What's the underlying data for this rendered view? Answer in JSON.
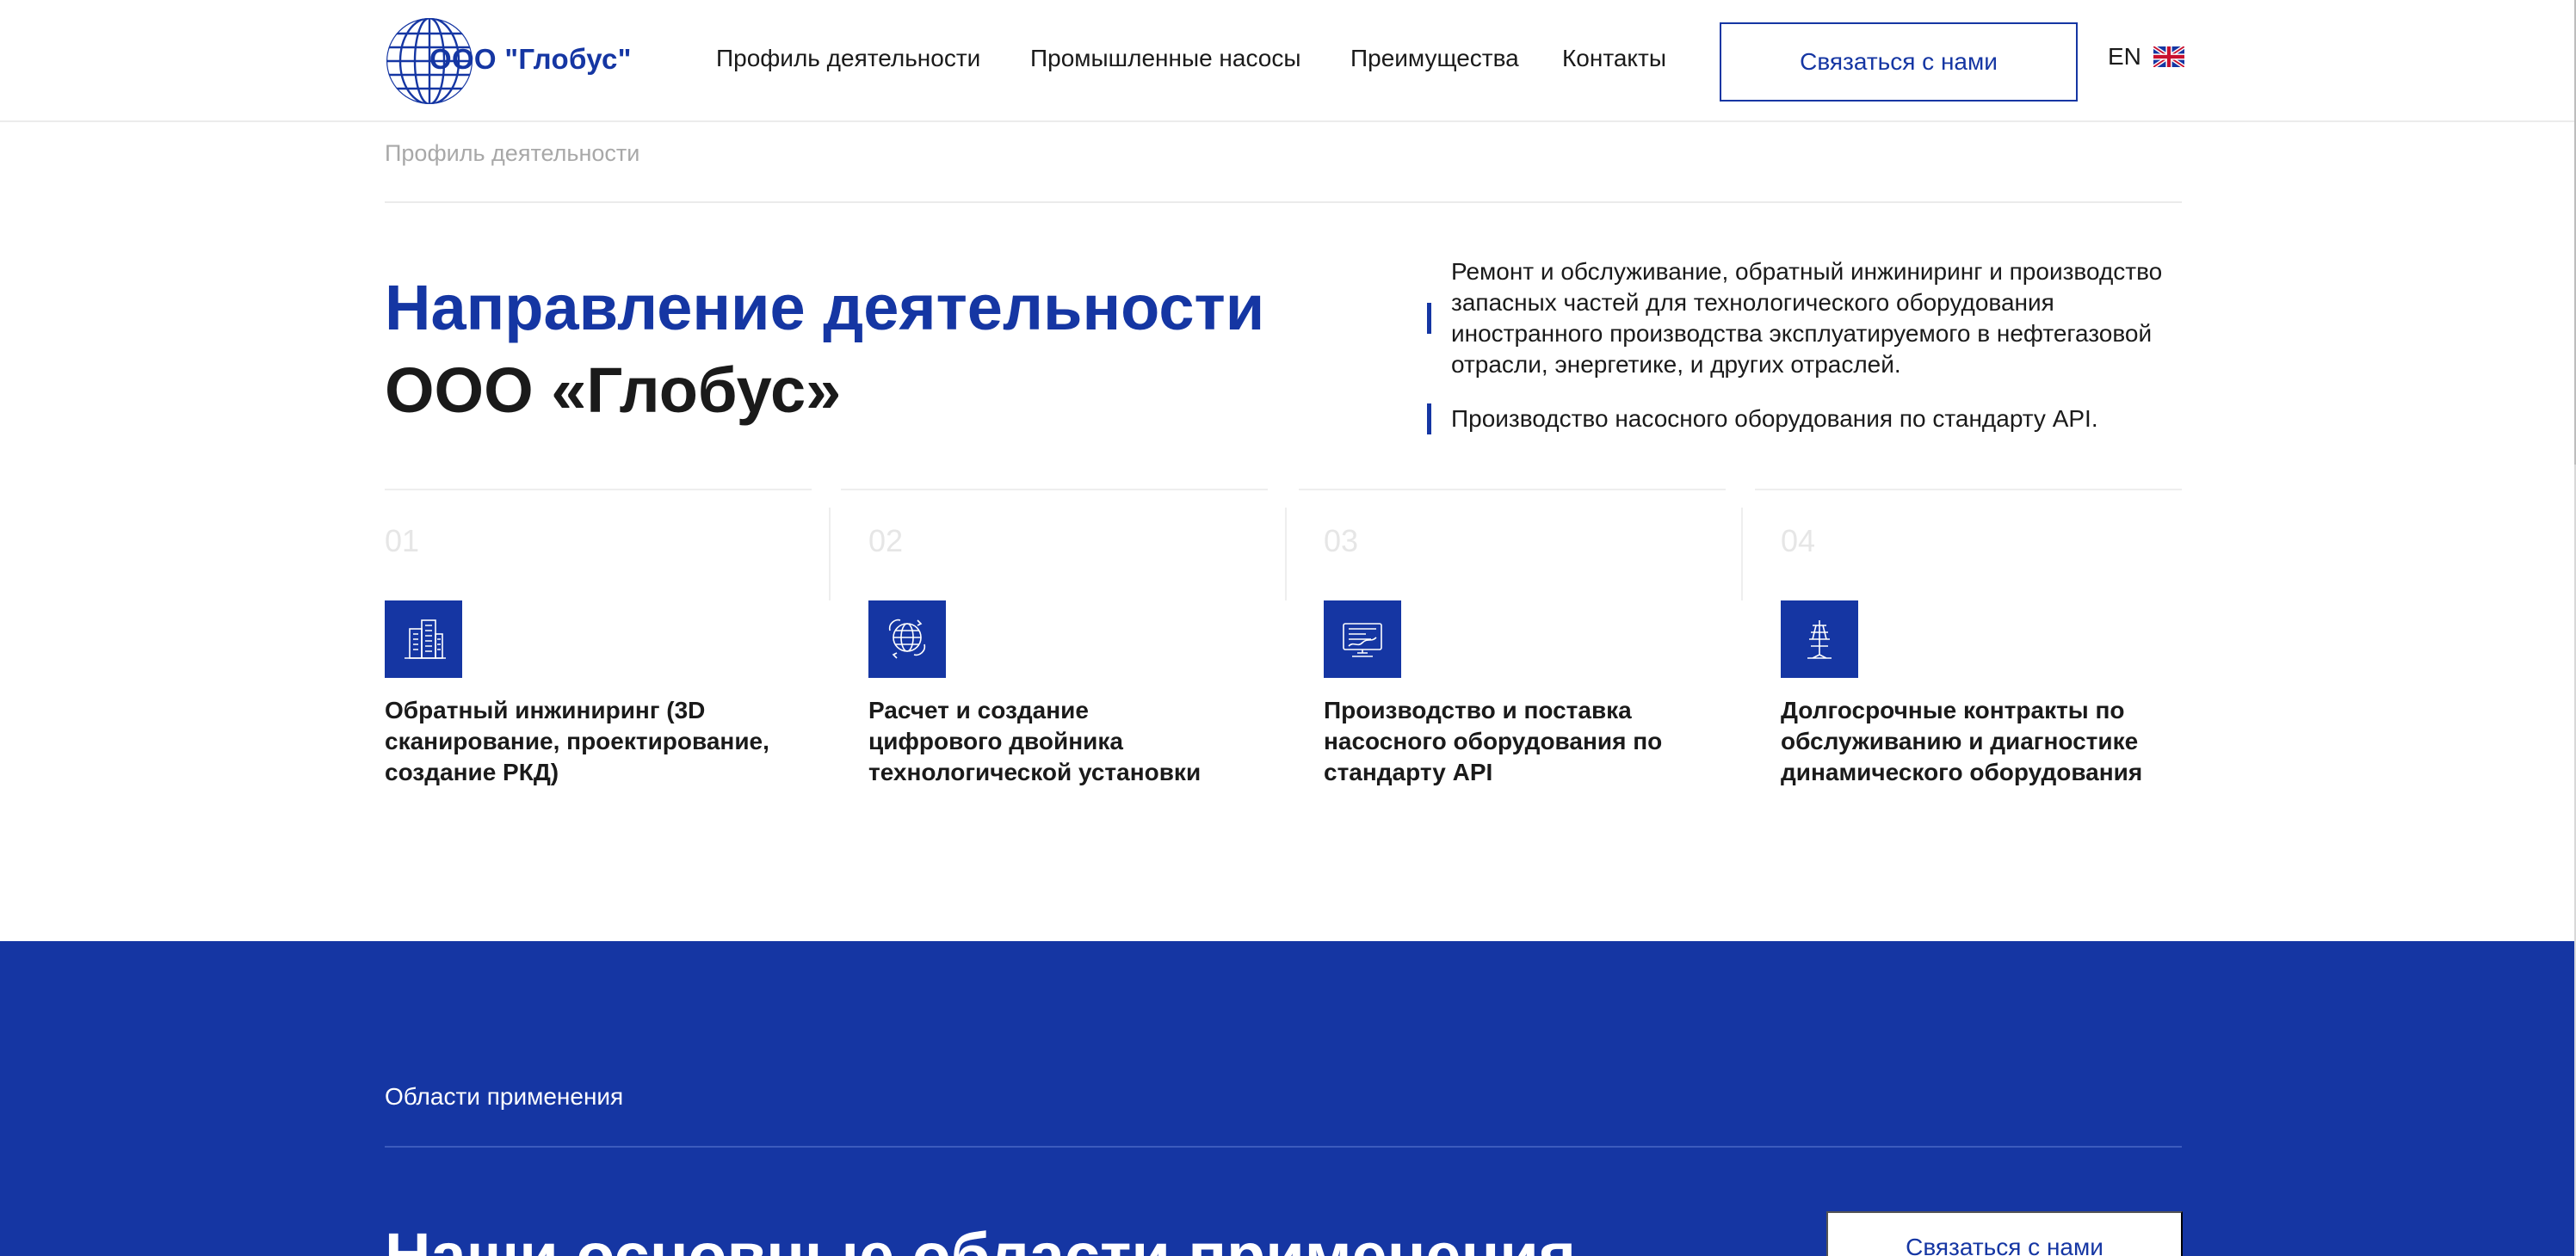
{
  "header": {
    "logo_text": "ООО \"Глобус\"",
    "nav": [
      {
        "label": "Профиль деятельности"
      },
      {
        "label": "Промышленные насосы"
      },
      {
        "label": "Преимущества"
      },
      {
        "label": "Контакты"
      }
    ],
    "contact_button": "Связаться с нами",
    "lang": {
      "label": "EN",
      "flag_icon": "uk-flag-icon"
    }
  },
  "breadcrumb": "Профиль деятельности",
  "hero": {
    "title_line_1": "Направление деятельности",
    "title_line_2": "ООО «Глобус»",
    "bullets": [
      {
        "lines": [
          "Ремонт и обслуживание, обратный инжиниринг и производство",
          "запасных частей для технологического оборудования",
          "иностранного производства эксплуатируемого в нефтегазовой",
          "отрасли, энергетике, и других отраслей."
        ]
      },
      {
        "lines": [
          "Производство насосного оборудования по стандарту API."
        ]
      }
    ]
  },
  "cards": [
    {
      "number": "01",
      "icon": "buildings-icon",
      "title_lines": [
        "Обратный инжиниринг (3D",
        "сканирование, проектирование,",
        "создание РКД)"
      ]
    },
    {
      "number": "02",
      "icon": "globe-network-icon",
      "title_lines": [
        "Расчет и создание",
        "цифрового двойника",
        "технологической установки"
      ]
    },
    {
      "number": "03",
      "icon": "monitor-chart-icon",
      "title_lines": [
        "Производство и поставка",
        "насосного оборудования по",
        "стандарту API"
      ]
    },
    {
      "number": "04",
      "icon": "antenna-tower-icon",
      "title_lines": [
        "Долгосрочные контракты по",
        "обслуживанию и диагностике",
        "динамического оборудования"
      ]
    }
  ],
  "applications": {
    "label": "Области применения",
    "heading": "Наши основные области применения",
    "button": "Связаться с нами"
  },
  "colors": {
    "brand_blue": "#1536a3",
    "text": "#1a1a1a",
    "muted": "#a8a8a8"
  }
}
